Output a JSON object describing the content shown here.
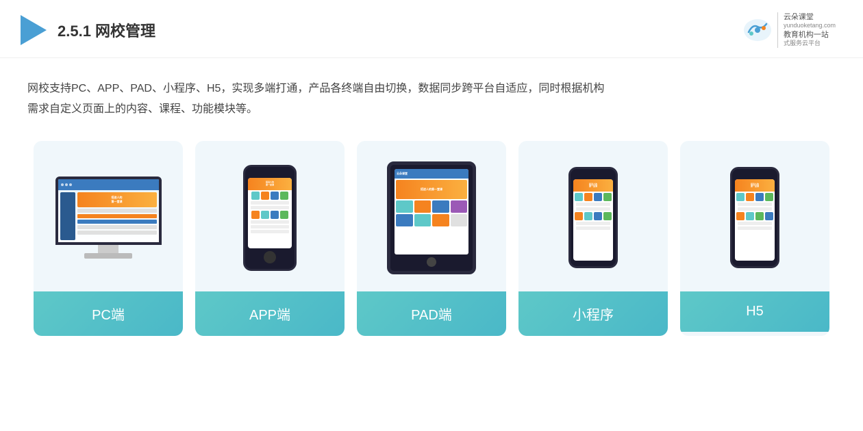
{
  "header": {
    "title_prefix": "2.5.1 ",
    "title_bold": "网校管理",
    "brand": {
      "name": "云朵课堂",
      "url": "yunduoketang.com",
      "tagline_line1": "教育机构一站",
      "tagline_line2": "式服务云平台"
    }
  },
  "description": {
    "text_line1": "网校支持PC、APP、PAD、小程序、H5，实现多端打通，产品各终端自由切换，数据同步跨平台自适应，同时根据机构",
    "text_line2": "需求自定义页面上的内容、课程、功能模块等。"
  },
  "cards": [
    {
      "id": "pc",
      "label": "PC端"
    },
    {
      "id": "app",
      "label": "APP端"
    },
    {
      "id": "pad",
      "label": "PAD端"
    },
    {
      "id": "mini",
      "label": "小程序"
    },
    {
      "id": "h5",
      "label": "H5"
    }
  ]
}
